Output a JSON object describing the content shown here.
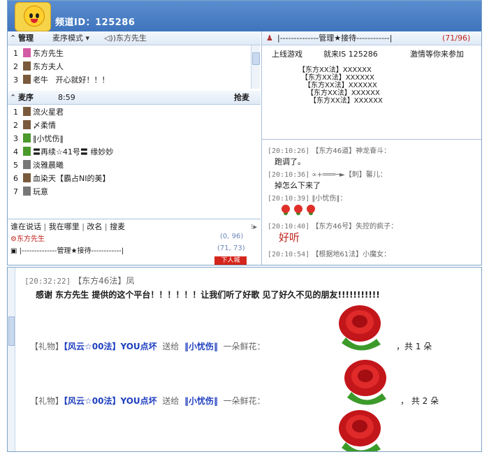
{
  "header": {
    "channel_id": "频道ID：125286"
  },
  "admin": {
    "title": "管理",
    "mic_mode": "麦序模式",
    "speaker": "东方先生",
    "members": [
      {
        "num": "1",
        "name": "东方先生",
        "icon": "person-icon",
        "color": "pink"
      },
      {
        "num": "2",
        "name": "东方夫人",
        "icon": "person-icon",
        "color": "brown"
      },
      {
        "num": "3",
        "name": "老牛",
        "extra": "开心就好！！！",
        "icon": "person-icon",
        "color": "brown"
      }
    ]
  },
  "mic_queue": {
    "title": "麦序",
    "time": "8:59",
    "grab_label": "抢麦",
    "members": [
      {
        "num": "1",
        "name": "流火星君",
        "color": "brown"
      },
      {
        "num": "2",
        "name": "〆柔情",
        "color": "brown"
      },
      {
        "num": "3",
        "name": "‖小忧伤‖",
        "color": "green"
      },
      {
        "num": "4",
        "name": "〓再续☆41号〓 缘妙妙",
        "color": "green"
      },
      {
        "num": "5",
        "name": "淡雅晨曦",
        "color": "gray"
      },
      {
        "num": "6",
        "name": "血染天【霸占NI的美】",
        "color": "brown"
      },
      {
        "num": "7",
        "name": "玩意",
        "color": "gray"
      }
    ]
  },
  "links": {
    "who_speaking": "谁在说话",
    "where_am_i": "我在哪里",
    "rename": "改名",
    "search": "搜麦"
  },
  "mini_list": {
    "speaker": "东方先生",
    "speaker_count": "(0, 96)",
    "banner": "|--------------管理★接待------------|",
    "banner_count": "(71, 73)",
    "badge": "下人城"
  },
  "notice": {
    "banner": "|--------------管理★接待------------|",
    "count": "(71/96)",
    "line1_a": "上线游戏",
    "line1_b": "就来IS 125286",
    "line1_c": "激情等你来参加",
    "lines": [
      "【东方XX法】XXXXXX",
      "【东方XX法】XXXXXX",
      "【东方XX法】XXXXXX",
      "【东方XX法】XXXXXX",
      "【东方XX法】XXXXXX"
    ]
  },
  "chat": [
    {
      "time": "[20:10:26]",
      "from": "【东方46道】神龙奋斗：",
      "msg": "跑调了。"
    },
    {
      "time": "[20:10:36]",
      "from": "∝+═══─►【刺】馨儿：",
      "msg": "掉怎么下来了"
    },
    {
      "time": "[20:10:39]",
      "from": "‖小忧伤‖：",
      "msg": ""
    },
    {
      "time": "[20:10:40]",
      "from": "【东方46号】失控的疯子：",
      "msg": "好听"
    },
    {
      "time": "[20:10:54]",
      "from": "【根据地61法】小魔女：",
      "msg": ""
    }
  ],
  "bottom": {
    "time": "[20:32:22]",
    "from": "【东方46法】凤",
    "message": "感谢 东方先生  提供的这个平台！！！！！！让我们听了好歌 见了好久不见的朋友!!!!!!!!!!!",
    "gifts": [
      {
        "prefix": "【礼物】",
        "sender": "【风云☆00法】YOU点坏",
        "verb": "送给",
        "receiver": "‖小忧伤‖",
        "item": "一朵鲜花：",
        "total": "，共 1 朵"
      },
      {
        "prefix": "【礼物】",
        "sender": "【风云☆00法】YOU点坏",
        "verb": "送给",
        "receiver": "‖小忧伤‖",
        "item": "一朵鲜花：",
        "total": "，  共 2 朵"
      }
    ]
  },
  "colors": {
    "header_blue": "#3f74bd",
    "accent_red": "#c0241c",
    "name_blue": "#1f3fbf"
  }
}
